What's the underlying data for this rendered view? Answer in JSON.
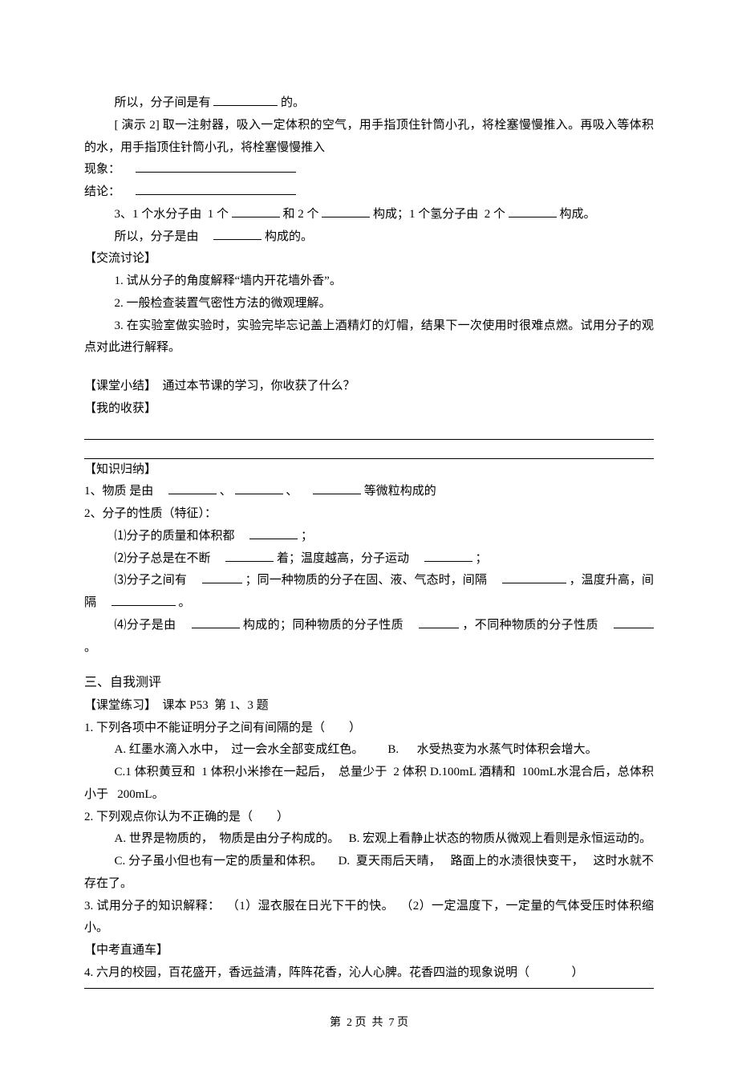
{
  "p1_prefix": "所以，分子间是有",
  "p1_suffix": "的。",
  "p2": "[ 演示 2] 取一注射器，吸入一定体积的空气，用手指顶住针筒小孔，将栓塞慢慢推入。再吸入等体积的水，用手指顶住针筒小孔，将栓塞慢慢推入",
  "p3": "现象：",
  "p4": "结论：",
  "p5_a": "3、1 个水分子由  1 个",
  "p5_b": "和 2 个",
  "p5_c": "构成；1 个氢分子由  2 个",
  "p5_d": "构成。",
  "p6_a": "所以，分子是由",
  "p6_b": "构成的。",
  "h_discuss": "【交流讨论】",
  "d1": "1. 试从分子的角度解释“墙内开花墙外香”。",
  "d2": "2. 一般检查装置气密性方法的微观理解。",
  "d3": "3. 在实验室做实验时，实验完毕忘记盖上酒精灯的灯帽，结果下一次使用时很难点燃。试用分子的观点对此进行解释。",
  "h_summary": "【课堂小结】  通过本节课的学习，你收获了什么？",
  "h_gain": "【我的收获】",
  "h_know": "【知识归纳】",
  "k1_a": "1、物质 是由",
  "k1_b": "、",
  "k1_c": "、",
  "k1_d": "等微粒构成的",
  "k2": "2、分子的性质（特征）：",
  "k2_1_a": "⑴分子的质量和体积都",
  "k2_1_b": "；",
  "k2_2_a": "⑵分子总是在不断",
  "k2_2_b": "着；温度越高，分子运动",
  "k2_2_c": "；",
  "k2_3_a": "⑶分子之间有",
  "k2_3_b": "；同一种物质的分子在固、液、气态时，间隔",
  "k2_3_c": "，温度升高，间隔",
  "k2_3_d": "。",
  "k2_4_a": "⑷分子是由",
  "k2_4_b": "构成的；同种物质的分子性质",
  "k2_4_c": "，不同种物质的分子性质",
  "k2_4_d": "。",
  "h_self": "三、自我测评",
  "h_class": "【课堂练习】  课本 P53  第 1、3 题",
  "q1": "1. 下列各项中不能证明分子之间有间隔的是（        ）",
  "q1_a": "A. 红墨水滴入水中，  过一会水全部变成红色。        B.      水受热变为水蒸气时体积会增大。",
  "q1_c": "C.1 体积黄豆和  1 体积小米掺在一起后，  总量少于  2 体积 D.100mL 酒精和  100mL水混合后，总体积小于   200mL。",
  "q2": "2. 下列观点你认为不正确的是（        ）",
  "q2_a": "A. 世界是物质的，  物质是由分子构成的。   B. 宏观上看静止状态的物质从微观上看则是永恒运动的。",
  "q2_c": "C. 分子虽小但也有一定的质量和体积。     D.  夏天雨后天晴，   路面上的水渍很快变干，   这时水就不存在了。",
  "q3": "3. 试用分子的知识解释：  （1）湿衣服在日光下干的快。  （2）一定温度下，一定量的气体受压时体积缩小。",
  "h_exam": "【中考直通车】",
  "q4": "4. 六月的校园，百花盛开，香远益清，阵阵花香，沁人心脾。花香四溢的现象说明（              ）",
  "footer": "第  2 页  共  7 页"
}
